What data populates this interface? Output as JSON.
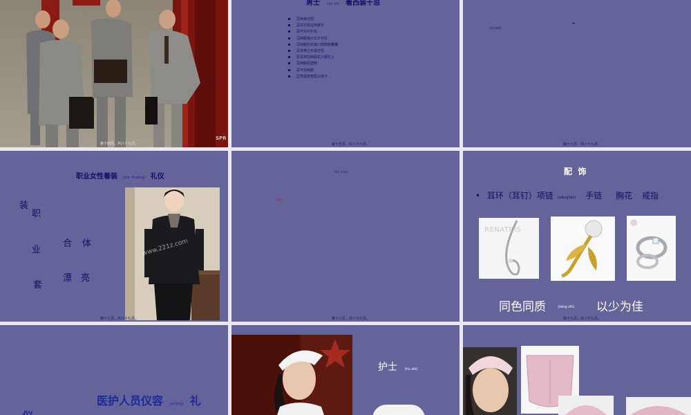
{
  "slide1": {
    "footer": "第十四页，共八十九页。",
    "watermark": "SPR"
  },
  "slide2": {
    "title_main": "男士",
    "title_pinyin": "nán shì",
    "title_rest": "着西装十忌",
    "items": [
      "忌西裤过短",
      "忌衬衫放在西裤外",
      "忌不扣衬衫扣",
      "忌西服袖子长于衬衫",
      "忌西服的衣袋口袋鼓鼓囊囊",
      "忌领带过长或过短",
      "忌单排扣西服扣子都扣上",
      "忌西服配便鞋",
      "忌不扣西服",
      "忌穿黑皮鞋配白袜子"
    ],
    "footer": "第十五页，共八十九页。"
  },
  "slide3": {
    "note": "(yúnwéi)",
    "footer": "第十六页，共八十九页。"
  },
  "slide4": {
    "title_main": "职业女性着装",
    "title_pinyin": "(zhe zhuāng)",
    "title_rest": "礼仪",
    "vert_col1": "装",
    "vert_col2": "职",
    "vert_col3": "业",
    "vert_col4": "套",
    "phrase1_a": "合",
    "phrase1_b": "体",
    "phrase2_a": "漂",
    "phrase2_b": "亮",
    "photo_watermark": "www.221z.com",
    "footer": "第十七页，共八十九页。"
  },
  "slide5": {
    "note": "（fēn yuǎn）",
    "red_text": "配饰",
    "footer": "第十八页，共八十九页。"
  },
  "slide6": {
    "title": "配  饰",
    "bullet": "•",
    "acc1": "耳环（耳钉）项链",
    "acc1_pinyin": "(xiàngliàn)",
    "acc2": "手链",
    "acc3": "胸花",
    "acc4": "戒指",
    "brand": "RENATRIS",
    "motto_a": "同色同质",
    "motto_pinyin": "(tóng zhì)",
    "motto_b": "以少为佳",
    "footer": "第十九页，共八十九页。"
  },
  "slide7": {
    "title_main": "医护人员仪容",
    "title_pinyin": "(yíróng)",
    "title_rest": "礼",
    "corner": "仪"
  },
  "slide8": {
    "label": "护士",
    "label_pinyin": "(hù shì)"
  },
  "slide9": {},
  "colors": {
    "slide_bg": "#64639a",
    "page_bg": "#e9e9ef",
    "navy_text": "#140f63",
    "white_text": "#ffffff",
    "red_text": "#c51c3a"
  }
}
